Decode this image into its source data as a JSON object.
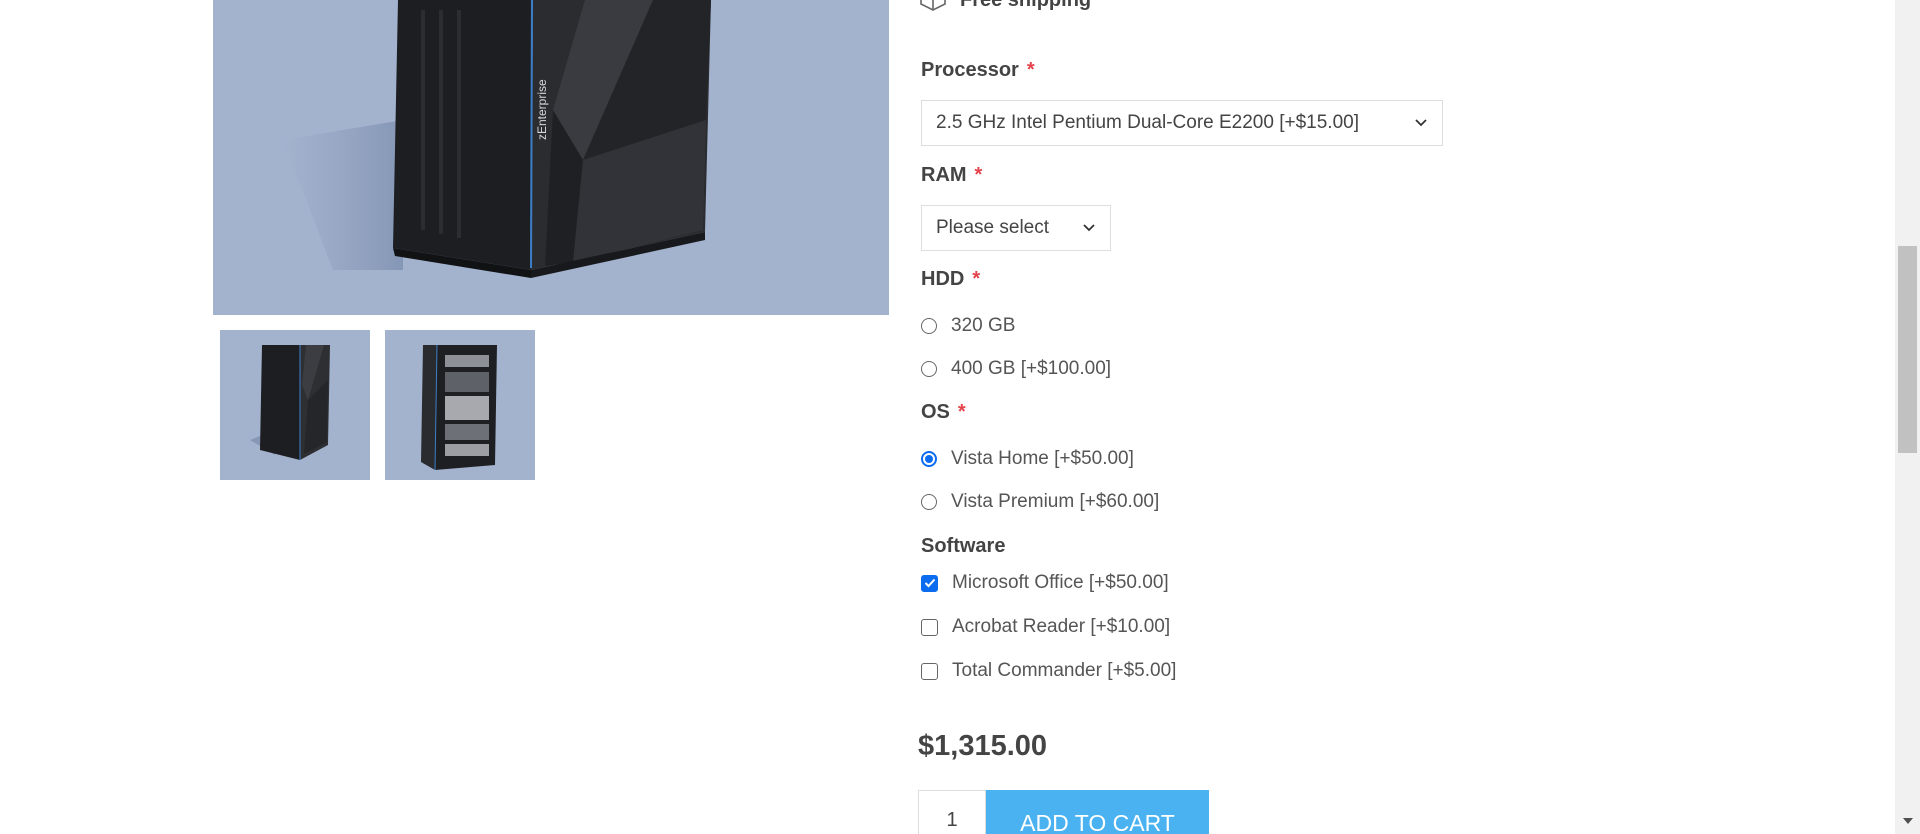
{
  "shipping": {
    "label": "Free shipping",
    "icon": "package-icon"
  },
  "attributes": {
    "processor": {
      "label": "Processor",
      "required_mark": "*",
      "selected": "2.5 GHz Intel Pentium Dual-Core E2200 [+$15.00]"
    },
    "ram": {
      "label": "RAM",
      "required_mark": "*",
      "selected": "Please select"
    },
    "hdd": {
      "label": "HDD",
      "required_mark": "*",
      "options": [
        {
          "label": "320 GB",
          "checked": false
        },
        {
          "label": "400 GB [+$100.00]",
          "checked": false
        }
      ]
    },
    "os": {
      "label": "OS",
      "required_mark": "*",
      "options": [
        {
          "label": "Vista Home [+$50.00]",
          "checked": true
        },
        {
          "label": "Vista Premium [+$60.00]",
          "checked": false
        }
      ]
    },
    "software": {
      "label": "Software",
      "options": [
        {
          "label": "Microsoft Office [+$50.00]",
          "checked": true
        },
        {
          "label": "Acrobat Reader [+$10.00]",
          "checked": false
        },
        {
          "label": "Total Commander [+$5.00]",
          "checked": false
        }
      ]
    }
  },
  "product": {
    "price": "$1,315.00",
    "quantity": "1",
    "add_to_cart_label": "ADD TO CART",
    "image_brand_text": "zEnterprise"
  },
  "colors": {
    "accent": "#4ab2f1",
    "required": "#e4434b",
    "checked": "#0b6cf0",
    "image_bg": "#a3b3ce"
  }
}
